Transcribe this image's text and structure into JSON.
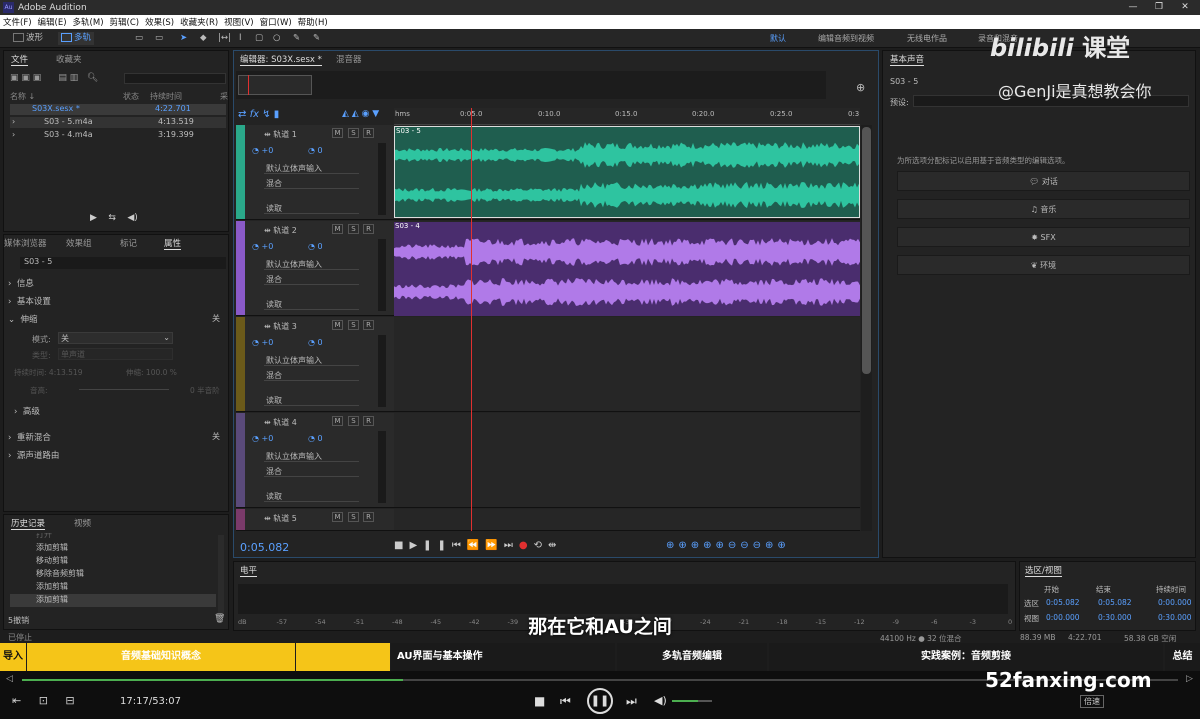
{
  "app_title": "Adobe Audition",
  "menu": [
    "文件(F)",
    "编辑(E)",
    "多轨(M)",
    "剪辑(C)",
    "效果(S)",
    "收藏夹(R)",
    "视图(V)",
    "窗口(W)",
    "帮助(H)"
  ],
  "toolbar": {
    "waveform_label": "波形",
    "multitrack_label": "多轨"
  },
  "workspaces": [
    "默认",
    "编辑音频到视频",
    "无线电作品",
    "录音和混音"
  ],
  "files_panel": {
    "tabs": [
      "文件",
      "收藏夹"
    ],
    "columns": [
      "名称 ↓",
      "状态",
      "持续时间",
      "采"
    ],
    "rows": [
      {
        "name": "S03X.sesx *",
        "duration": "4:22.701"
      },
      {
        "name": "S03 - 5.m4a",
        "duration": "4:13.519"
      },
      {
        "name": "S03 - 4.m4a",
        "duration": "3:19.399"
      }
    ]
  },
  "props_panel": {
    "tabs": [
      "媒体浏览器",
      "效果组",
      "标记",
      "属性"
    ],
    "clip_name": "S03 - 5",
    "sections": [
      "信息",
      "基本设置",
      "伸缩",
      "高级",
      "重新混合",
      "源声道路由"
    ],
    "mode_label": "模式:",
    "mode_value": "关",
    "type_label": "类型:",
    "type_value": "单声道",
    "duration_label": "持续时间:",
    "duration_value": "4:13.519",
    "stretch_label": "伸缩:",
    "stretch_value": "100.0 %",
    "pitch_label": "音高:",
    "pitch_value": "0 半音阶",
    "off_label": "关"
  },
  "history_panel": {
    "tabs": [
      "历史记录",
      "视频"
    ],
    "items": [
      "打开",
      "添加剪辑",
      "移动剪辑",
      "移除音频剪辑",
      "添加剪辑",
      "添加剪辑"
    ],
    "footer": "5撤销",
    "status": "已停止"
  },
  "editor": {
    "tabs": [
      "编辑器: S03X.sesx *",
      "混音器"
    ],
    "ruler": [
      "hms",
      "0:05.0",
      "0:10.0",
      "0:15.0",
      "0:20.0",
      "0:25.0",
      "0:3"
    ],
    "time": "0:05.082",
    "tracks": [
      {
        "name": "轨道 1",
        "vol": "+0",
        "pan": "0",
        "input": "默认立体声输入",
        "mix": "混合",
        "read": "读取",
        "clip": "S03 - 5",
        "color": "#2ec4a0"
      },
      {
        "name": "轨道 2",
        "vol": "+0",
        "pan": "0",
        "input": "默认立体声输入",
        "mix": "混合",
        "read": "读取",
        "clip": "S03 - 4",
        "color": "#b07ae8"
      },
      {
        "name": "轨道 3",
        "vol": "+0",
        "pan": "0",
        "input": "默认立体声输入",
        "mix": "混合",
        "read": "读取",
        "clip": "",
        "color": ""
      },
      {
        "name": "轨道 4",
        "vol": "+0",
        "pan": "0",
        "input": "默认立体声输入",
        "mix": "混合",
        "read": "读取",
        "clip": "",
        "color": ""
      },
      {
        "name": "轨道 5",
        "vol": "",
        "pan": "",
        "input": "",
        "mix": "",
        "read": "",
        "clip": "",
        "color": ""
      }
    ],
    "strip_colors": [
      "#2aa88a",
      "#8a5ac8",
      "#6b5a1a",
      "#5a4a7a",
      "#7a3a6a"
    ]
  },
  "essential_sound": {
    "title": "基本声音",
    "clip": "S03 - 5",
    "preset_label": "预设:",
    "hint": "为所选项分配标记以启用基于音频类型的编辑选项。",
    "buttons": [
      "对话",
      "音乐",
      "SFX",
      "环境"
    ]
  },
  "meter": {
    "title": "电平",
    "scale": [
      "dB",
      "-57",
      "-54",
      "-51",
      "-48",
      "-45",
      "-42",
      "-39",
      "-36",
      "-33",
      "-30",
      "-27",
      "-24",
      "-21",
      "-18",
      "-15",
      "-12",
      "-9",
      "-6",
      "-3",
      "0"
    ]
  },
  "selection": {
    "title": "选区/视图",
    "cols": [
      "开始",
      "结束",
      "持续时间"
    ],
    "rows": [
      {
        "label": "选区",
        "start": "0:05.082",
        "end": "0:05.082",
        "dur": "0:00.000"
      },
      {
        "label": "视图",
        "start": "0:00.000",
        "end": "0:30.000",
        "dur": "0:30.000"
      }
    ]
  },
  "statusbar": {
    "rate": "44100 Hz ● 32 位混合",
    "size": "88.39 MB",
    "dur": "4:22.701",
    "free": "58.38 GB 空闲"
  },
  "subtitle": "那在它和AU之间",
  "watermark": {
    "bili": "bilibili",
    "ketang": "课堂",
    "author": "@GenJi是真想教会你",
    "site": "52fanxing.com"
  },
  "chapters": [
    "导入",
    "音频基础知识概念",
    "AU界面与基本操作",
    "多轨音频编辑",
    "实践案例：音频剪接",
    "总结"
  ],
  "player": {
    "time": "17:17/53:07",
    "speed": "倍速",
    "progress": 0.33
  }
}
